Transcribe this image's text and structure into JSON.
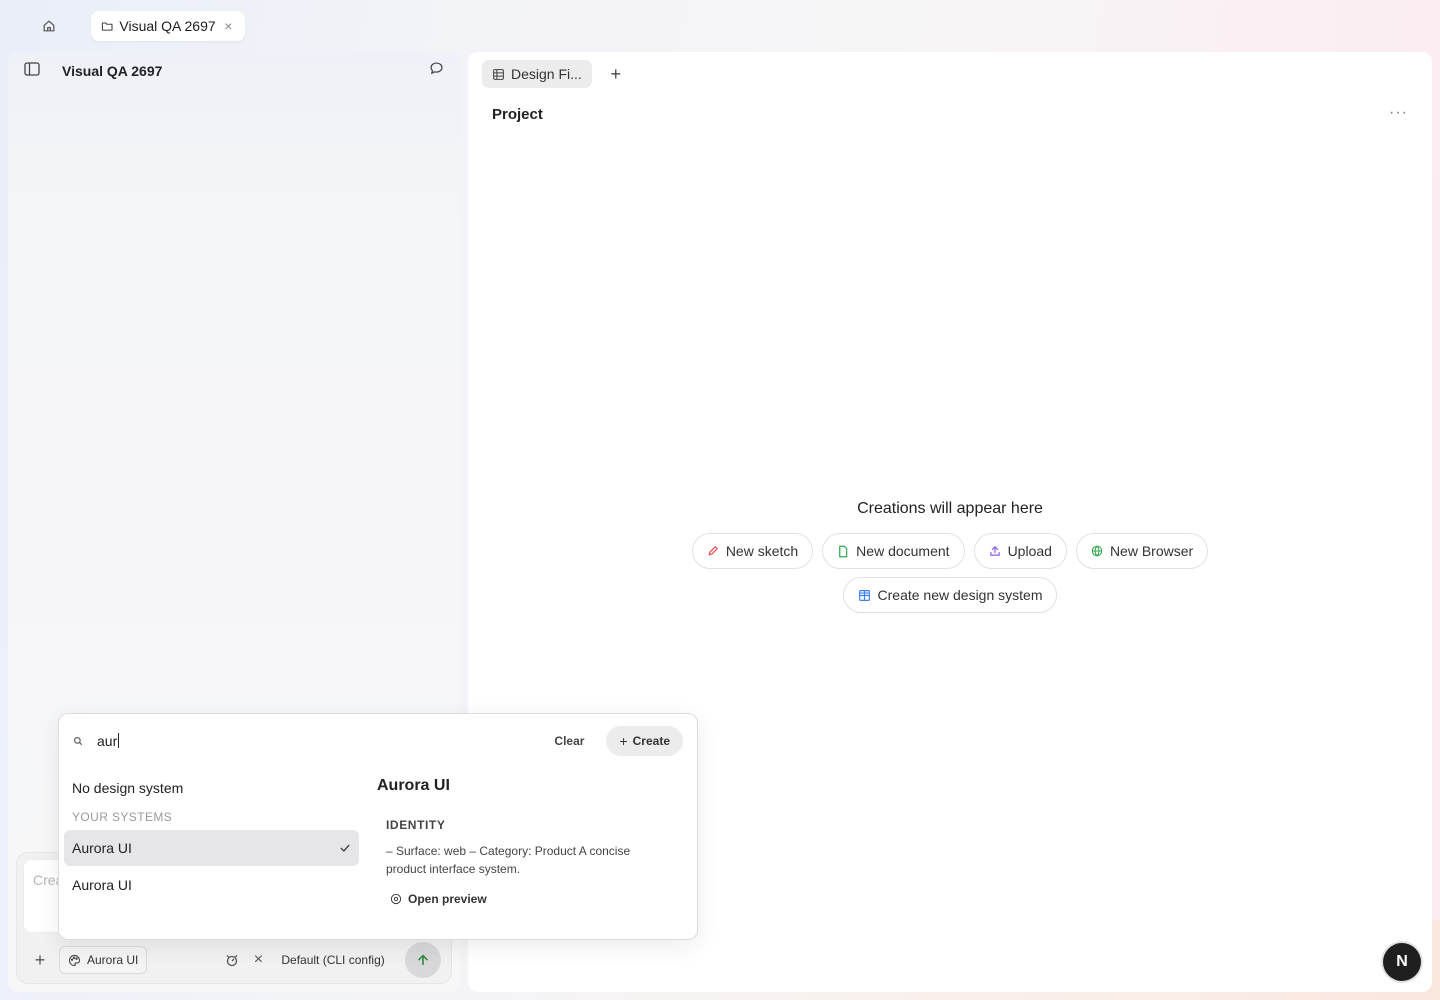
{
  "topbar": {
    "home_icon": "home-icon",
    "tab": {
      "icon": "folder-icon",
      "label": "Visual QA 2697",
      "close": "×"
    }
  },
  "left_panel": {
    "title": "Visual QA 2697",
    "composer": {
      "placeholder": "Crea",
      "design_system_chip": "Aurora UI",
      "model": "Default (CLI config)",
      "remove": "×",
      "add": "+"
    }
  },
  "right_panel": {
    "tabs": [
      {
        "icon": "grid-icon",
        "label": "Design Fi..."
      }
    ],
    "add_tab": "+",
    "title": "Project",
    "more": "···",
    "empty_state": {
      "title": "Creations will appear here",
      "actions": [
        {
          "label": "New sketch",
          "icon": "pencil-icon",
          "color": "#e5484d"
        },
        {
          "label": "New document",
          "icon": "document-icon",
          "color": "#2fa84f"
        },
        {
          "label": "Upload",
          "icon": "upload-icon",
          "color": "#8b5cf6"
        },
        {
          "label": "New Browser",
          "icon": "globe-icon",
          "color": "#2fa84f"
        }
      ],
      "secondary_action": {
        "label": "Create new design system",
        "icon": "grid-icon",
        "color": "#3b82f6"
      }
    }
  },
  "design_system_picker": {
    "search_value": "aur",
    "clear_label": "Clear",
    "create_label": "Create",
    "no_system_label": "No design system",
    "group_label": "YOUR SYSTEMS",
    "options": [
      {
        "name": "Aurora UI",
        "selected": true
      },
      {
        "name": "Aurora UI",
        "selected": false
      }
    ],
    "detail": {
      "title": "Aurora UI",
      "section_label": "IDENTITY",
      "description": "– Surface: web – Category: Product A concise product interface system.",
      "open_preview_label": "Open preview"
    }
  },
  "user": {
    "avatar_letter": "N"
  }
}
